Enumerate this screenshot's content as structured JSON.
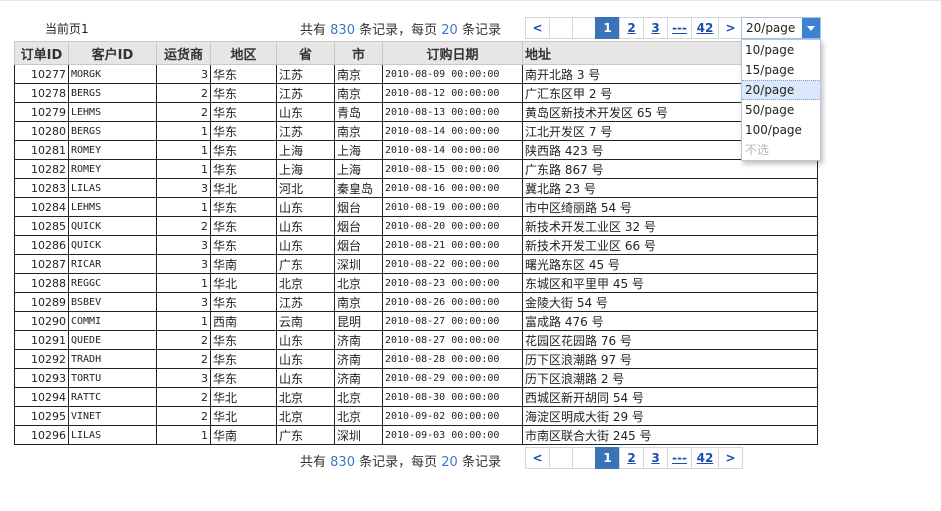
{
  "current_page_label": "当前页1",
  "summary": {
    "prefix": "共有",
    "total": "830",
    "mid": "条记录，每页",
    "per_page": "20",
    "suffix": "条记录"
  },
  "pager": {
    "prev": "<",
    "next": ">",
    "pages": [
      "1",
      "2",
      "3"
    ],
    "ellipsis": "---",
    "last": "42"
  },
  "page_size": {
    "value": "20/page",
    "options": [
      "10/page",
      "15/page",
      "20/page",
      "50/page",
      "100/page",
      "不选"
    ]
  },
  "table": {
    "headers": [
      "订单ID",
      "客户ID",
      "运货商",
      "地区",
      "省",
      "市",
      "订购日期",
      "地址"
    ],
    "rows": [
      [
        "10277",
        "MORGK",
        "3",
        "华东",
        "江苏",
        "南京",
        "2010-08-09 00:00:00",
        "南开北路 3 号"
      ],
      [
        "10278",
        "BERGS",
        "2",
        "华东",
        "江苏",
        "南京",
        "2010-08-12 00:00:00",
        "广汇东区甲 2 号"
      ],
      [
        "10279",
        "LEHMS",
        "2",
        "华东",
        "山东",
        "青岛",
        "2010-08-13 00:00:00",
        "黄岛区新技术开发区 65 号"
      ],
      [
        "10280",
        "BERGS",
        "1",
        "华东",
        "江苏",
        "南京",
        "2010-08-14 00:00:00",
        "江北开发区 7 号"
      ],
      [
        "10281",
        "ROMEY",
        "1",
        "华东",
        "上海",
        "上海",
        "2010-08-14 00:00:00",
        "陕西路 423 号"
      ],
      [
        "10282",
        "ROMEY",
        "1",
        "华东",
        "上海",
        "上海",
        "2010-08-15 00:00:00",
        "广东路 867 号"
      ],
      [
        "10283",
        "LILAS",
        "3",
        "华北",
        "河北",
        "秦皇岛",
        "2010-08-16 00:00:00",
        "冀北路 23 号"
      ],
      [
        "10284",
        "LEHMS",
        "1",
        "华东",
        "山东",
        "烟台",
        "2010-08-19 00:00:00",
        "市中区绮丽路 54 号"
      ],
      [
        "10285",
        "QUICK",
        "2",
        "华东",
        "山东",
        "烟台",
        "2010-08-20 00:00:00",
        "新技术开发工业区 32 号"
      ],
      [
        "10286",
        "QUICK",
        "3",
        "华东",
        "山东",
        "烟台",
        "2010-08-21 00:00:00",
        "新技术开发工业区 66 号"
      ],
      [
        "10287",
        "RICAR",
        "3",
        "华南",
        "广东",
        "深圳",
        "2010-08-22 00:00:00",
        "曙光路东区 45 号"
      ],
      [
        "10288",
        "REGGC",
        "1",
        "华北",
        "北京",
        "北京",
        "2010-08-23 00:00:00",
        "东城区和平里甲 45 号"
      ],
      [
        "10289",
        "BSBEV",
        "3",
        "华东",
        "江苏",
        "南京",
        "2010-08-26 00:00:00",
        "金陵大街 54 号"
      ],
      [
        "10290",
        "COMMI",
        "1",
        "西南",
        "云南",
        "昆明",
        "2010-08-27 00:00:00",
        "富成路 476 号"
      ],
      [
        "10291",
        "QUEDE",
        "2",
        "华东",
        "山东",
        "济南",
        "2010-08-27 00:00:00",
        "花园区花园路 76 号"
      ],
      [
        "10292",
        "TRADH",
        "2",
        "华东",
        "山东",
        "济南",
        "2010-08-28 00:00:00",
        "历下区浪潮路 97 号"
      ],
      [
        "10293",
        "TORTU",
        "3",
        "华东",
        "山东",
        "济南",
        "2010-08-29 00:00:00",
        "历下区浪潮路 2 号"
      ],
      [
        "10294",
        "RATTC",
        "2",
        "华北",
        "北京",
        "北京",
        "2010-08-30 00:00:00",
        "西城区新开胡同 54 号"
      ],
      [
        "10295",
        "VINET",
        "2",
        "华北",
        "北京",
        "北京",
        "2010-09-02 00:00:00",
        "海淀区明成大街 29 号"
      ],
      [
        "10296",
        "LILAS",
        "1",
        "华南",
        "广东",
        "深圳",
        "2010-09-03 00:00:00",
        "市南区联合大街 245 号"
      ]
    ]
  }
}
